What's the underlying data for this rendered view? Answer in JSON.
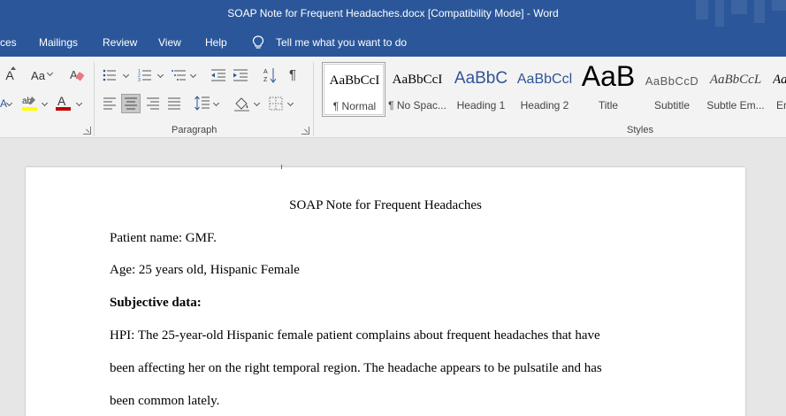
{
  "title_bar": {
    "title": "SOAP Note for Frequent Headaches.docx [Compatibility Mode]  -  Word"
  },
  "menu": {
    "items": [
      "ces",
      "Mailings",
      "Review",
      "View",
      "Help"
    ],
    "tell_me": "Tell me what you want to do"
  },
  "ribbon": {
    "font_group": {
      "change_case": "Aa",
      "grow_font": "A",
      "font_color_letter": "A",
      "highlight_color": "#ffff00",
      "font_color": "#c00000"
    },
    "paragraph_group": {
      "label": "Paragraph",
      "pilcrow": "¶"
    },
    "styles_group": {
      "label": "Styles",
      "items": [
        {
          "sample": "AaBbCcI",
          "name": "¶ Normal"
        },
        {
          "sample": "AaBbCcI",
          "name": "¶ No Spac..."
        },
        {
          "sample": "AaBbC",
          "name": "Heading 1"
        },
        {
          "sample": "AaBbCcl",
          "name": "Heading 2"
        },
        {
          "sample": "AaB",
          "name": "Title"
        },
        {
          "sample": "AaBbCcD",
          "name": "Subtitle"
        },
        {
          "sample": "AaBbCcL",
          "name": "Subtle Em..."
        },
        {
          "sample": "Aa",
          "name": "En"
        }
      ]
    }
  },
  "document": {
    "heading": "SOAP Note for Frequent Headaches",
    "patient_name": "Patient name: GMF.",
    "age": "Age: 25 years old, Hispanic Female",
    "subjective_heading": "Subjective data:",
    "hpi_line1": "HPI: The 25-year-old Hispanic female patient complains about frequent headaches that have",
    "hpi_line2": "been affecting her on the right temporal region. The headache appears to be pulsatile and has",
    "hpi_line3": "been common lately."
  },
  "colors": {
    "title_bar": "#2b579a",
    "heading_style": "#2f5496"
  }
}
